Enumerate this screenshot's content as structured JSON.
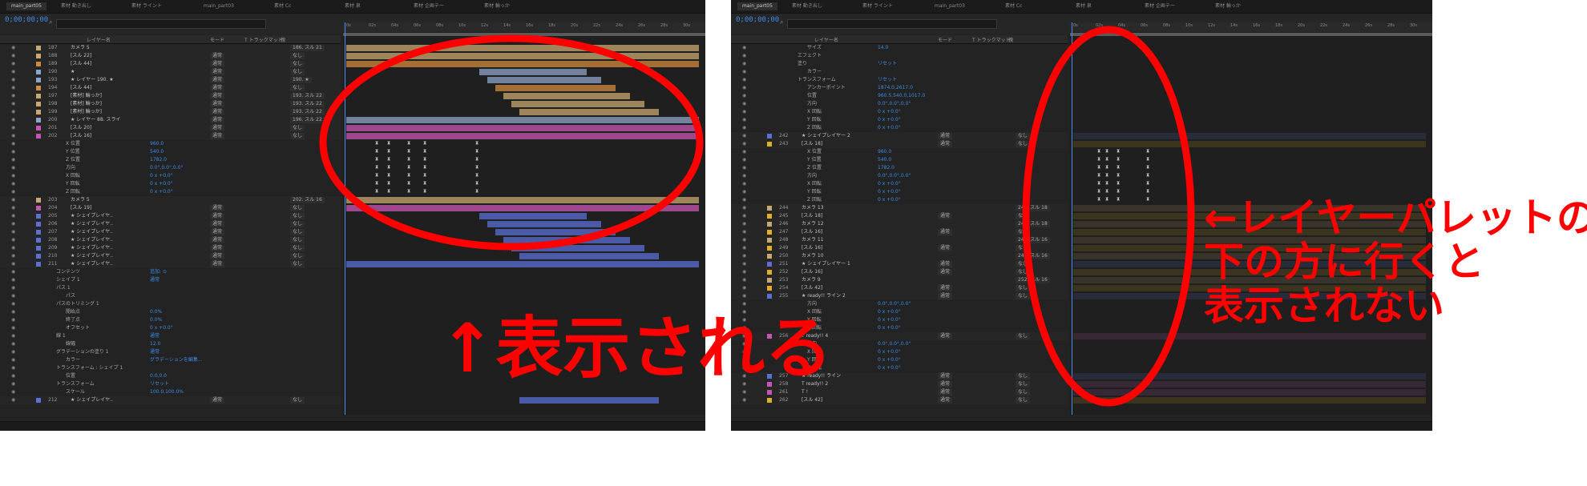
{
  "colors": {
    "annotation": "#ff0000",
    "timecode": "#3d8be6",
    "panel_bg": "#232323"
  },
  "annotations": {
    "shown": "↑表示される",
    "not_shown": "←レイヤーパレットの\n下の方に行くと\n表示されない"
  },
  "panels": [
    {
      "id": "p1",
      "tabs": [
        "main_part05",
        "素材 動き出し",
        "素材 ライント",
        "main_part03",
        "素材 Cc",
        "素材 泉",
        "素材 企画テー",
        "素材 輪っか"
      ],
      "timecode": "0;00;00;00",
      "search_icon": "search-icon",
      "columns": {
        "layer_name": "レイヤー名",
        "mode": "モード",
        "track_matte": "T トラックマット",
        "parent": "親"
      },
      "ruler": [
        "0s",
        "02s",
        "04s",
        "06s",
        "08s",
        "10s",
        "12s",
        "14s",
        "16s",
        "18s",
        "20s",
        "22s",
        "24s",
        "26s",
        "28s",
        "30s"
      ],
      "rows": [
        {
          "n": "187",
          "name": "カメラ 5",
          "kind": "layer",
          "color": "#c9a870",
          "parent": "186. スル 21"
        },
        {
          "n": "188",
          "name": "[スル 22]",
          "kind": "layer",
          "color": "#c9a870",
          "mode": "通常",
          "parent": "なし"
        },
        {
          "n": "189",
          "name": "[スル 44]",
          "kind": "layer",
          "color": "#d18b3c",
          "mode": "通常",
          "parent": "なし"
        },
        {
          "n": "190",
          "name": "★",
          "kind": "layer",
          "color": "#8fa3c8",
          "mode": "通常",
          "parent": "なし"
        },
        {
          "n": "193",
          "name": "★ レイヤー 190. ★",
          "kind": "layer",
          "color": "#8fa3c8",
          "mode": "通常",
          "parent": "190. ★"
        },
        {
          "n": "194",
          "name": "[スル 44]",
          "kind": "layer",
          "color": "#d18b3c",
          "mode": "通常",
          "parent": "なし"
        },
        {
          "n": "197",
          "name": "[素材] 輪っか]",
          "kind": "layer",
          "color": "#c9a870",
          "mode": "通常",
          "parent": "193. スル 22"
        },
        {
          "n": "198",
          "name": "[素材] 輪っか]",
          "kind": "layer",
          "color": "#c9a870",
          "mode": "通常",
          "parent": "193. スル 22"
        },
        {
          "n": "199",
          "name": "[素材] 輪っか]",
          "kind": "layer",
          "color": "#c9a870",
          "mode": "通常",
          "parent": "193. スル 22"
        },
        {
          "n": "200",
          "name": "★ レイヤー 88. スライ",
          "kind": "layer",
          "color": "#8fa3c8",
          "mode": "通常",
          "parent": "196. スル 22"
        },
        {
          "n": "201",
          "name": "[スル 20]",
          "kind": "layer",
          "color": "#c855b5",
          "mode": "通常",
          "parent": "なし"
        },
        {
          "n": "202",
          "name": "[スル 16]",
          "kind": "layer",
          "color": "#c855b5",
          "mode": "通常",
          "parent": "なし"
        },
        {
          "name": "X 位置",
          "kind": "prop",
          "value": "960.0"
        },
        {
          "name": "Y 位置",
          "kind": "prop",
          "value": "540.0"
        },
        {
          "name": "Z 位置",
          "kind": "prop",
          "value": "1782.0"
        },
        {
          "name": "方向",
          "kind": "prop",
          "value": "0.0°,0.0°,0.0°"
        },
        {
          "name": "X 回転",
          "kind": "prop",
          "value": "0 x +0.0°"
        },
        {
          "name": "Y 回転",
          "kind": "prop",
          "value": "0 x +0.0°"
        },
        {
          "name": "Z 回転",
          "kind": "prop",
          "value": "0 x +0.0°"
        },
        {
          "n": "203",
          "name": "カメラ 5",
          "kind": "layer",
          "color": "#c9a870",
          "parent": "202. スル 16"
        },
        {
          "n": "204",
          "name": "[スル 19]",
          "kind": "layer",
          "color": "#c855b5",
          "mode": "通常",
          "parent": "なし"
        },
        {
          "n": "205",
          "name": "★ シェイプレイヤ..",
          "kind": "layer",
          "color": "#5b6fd6",
          "mode": "通常",
          "parent": "なし"
        },
        {
          "n": "206",
          "name": "★ シェイプレイヤ..",
          "kind": "layer",
          "color": "#5b6fd6",
          "mode": "通常",
          "parent": "なし"
        },
        {
          "n": "207",
          "name": "★ シェイプレイヤ..",
          "kind": "layer",
          "color": "#5b6fd6",
          "mode": "通常",
          "parent": "なし"
        },
        {
          "n": "208",
          "name": "★ シェイプレイヤ..",
          "kind": "layer",
          "color": "#5b6fd6",
          "mode": "通常",
          "parent": "なし"
        },
        {
          "n": "209",
          "name": "★ シェイプレイヤ..",
          "kind": "layer",
          "color": "#5b6fd6",
          "mode": "通常",
          "parent": "なし"
        },
        {
          "n": "210",
          "name": "★ シェイプレイヤ..",
          "kind": "layer",
          "color": "#5b6fd6",
          "mode": "通常",
          "parent": "なし"
        },
        {
          "n": "211",
          "name": "★ シェイプレイヤ..",
          "kind": "layer",
          "color": "#5b6fd6",
          "mode": "通常",
          "parent": "なし"
        },
        {
          "name": "コンテンツ",
          "kind": "group",
          "value": "追加: ⊙"
        },
        {
          "name": "シェイプ 1",
          "kind": "group",
          "value": "通常"
        },
        {
          "name": "パス 1",
          "kind": "group"
        },
        {
          "name": "パス",
          "kind": "prop"
        },
        {
          "name": "パスのトリミング 1",
          "kind": "group"
        },
        {
          "name": "開始点",
          "kind": "prop",
          "value": "0.0%"
        },
        {
          "name": "終了点",
          "kind": "prop",
          "value": "0.0%"
        },
        {
          "name": "オフセット",
          "kind": "prop",
          "value": "0 x +0.0°"
        },
        {
          "name": "線 1",
          "kind": "group",
          "value": "通常"
        },
        {
          "name": "線幅",
          "kind": "prop",
          "value": "12.0"
        },
        {
          "name": "グラデーションの塗り 1",
          "kind": "group",
          "value": "通常"
        },
        {
          "name": "カラー",
          "kind": "prop",
          "value": "グラデーションを編集..."
        },
        {
          "name": "トランスフォーム : シェイプ 1",
          "kind": "group"
        },
        {
          "name": "位置",
          "kind": "prop",
          "value": "0.0,0.0"
        },
        {
          "name": "トランスフォーム",
          "kind": "group",
          "value": "リセット"
        },
        {
          "name": "スケール",
          "kind": "prop",
          "value": "100.0,100.0%"
        },
        {
          "n": "212",
          "name": "★ シェイプレイヤ..",
          "kind": "layer",
          "color": "#5b6fd6",
          "mode": "通常",
          "parent": "なし"
        }
      ]
    },
    {
      "id": "p2",
      "tabs": [
        "main_part05",
        "素材 動き出し",
        "素材 ライント",
        "main_part03",
        "素材 Cc",
        "素材 泉",
        "素材 企画テー",
        "素材 輪っか"
      ],
      "timecode": "0;00;00;00",
      "search_icon": "search-icon",
      "columns": {
        "layer_name": "レイヤー名",
        "mode": "モード",
        "track_matte": "T トラックマット",
        "parent": "親"
      },
      "ruler": [
        "0s",
        "02s",
        "04s",
        "06s",
        "08s",
        "10s",
        "12s",
        "14s",
        "16s",
        "18s",
        "20s",
        "22s",
        "24s",
        "26s",
        "28s",
        "30s"
      ],
      "rows": [
        {
          "name": "サイズ",
          "kind": "prop",
          "value": "14.0"
        },
        {
          "name": "エフェクト",
          "kind": "group"
        },
        {
          "name": "塗り",
          "kind": "group",
          "value": "リセット"
        },
        {
          "name": "カラー",
          "kind": "prop"
        },
        {
          "name": "トランスフォーム",
          "kind": "group",
          "value": "リセット"
        },
        {
          "name": "アンカーポイント",
          "kind": "prop",
          "value": "1874.0,2617.0"
        },
        {
          "name": "位置",
          "kind": "prop",
          "value": "960.5,540.0,1017.0"
        },
        {
          "name": "方向",
          "kind": "prop",
          "value": "0.0°,0.0°,0.0°"
        },
        {
          "name": "X 回転",
          "kind": "prop",
          "value": "0 x +0.0°"
        },
        {
          "name": "Y 回転",
          "kind": "prop",
          "value": "0 x +0.0°"
        },
        {
          "name": "Z 回転",
          "kind": "prop",
          "value": "0 x +0.0°"
        },
        {
          "n": "242",
          "name": "★ シェイプレイヤー 2",
          "kind": "layer",
          "color": "#5b6fd6",
          "mode": "通常",
          "parent": "なし"
        },
        {
          "n": "243",
          "name": "[スル 18]",
          "kind": "layer",
          "color": "#e0b020",
          "mode": "通常",
          "parent": "なし"
        },
        {
          "name": "X 位置",
          "kind": "prop",
          "value": "960.0"
        },
        {
          "name": "Y 位置",
          "kind": "prop",
          "value": "540.0"
        },
        {
          "name": "Z 位置",
          "kind": "prop",
          "value": "1782.0"
        },
        {
          "name": "方向",
          "kind": "prop",
          "value": "0.0°,0.0°,0.0°"
        },
        {
          "name": "X 回転",
          "kind": "prop",
          "value": "0 x +0.0°"
        },
        {
          "name": "Y 回転",
          "kind": "prop",
          "value": "0 x +0.0°"
        },
        {
          "name": "Z 回転",
          "kind": "prop",
          "value": "0 x +0.0°"
        },
        {
          "n": "244",
          "name": "カメラ 13",
          "kind": "layer",
          "color": "#c9a870",
          "parent": "243. スル 18"
        },
        {
          "n": "245",
          "name": "[スル 18]",
          "kind": "layer",
          "color": "#e0b020",
          "mode": "通常",
          "parent": "なし"
        },
        {
          "n": "246",
          "name": "カメラ 12",
          "kind": "layer",
          "color": "#c9a870",
          "parent": "245. スル 18"
        },
        {
          "n": "247",
          "name": "[スル 16]",
          "kind": "layer",
          "color": "#e0b020",
          "mode": "通常",
          "parent": "なし"
        },
        {
          "n": "248",
          "name": "カメラ 11",
          "kind": "layer",
          "color": "#c9a870",
          "parent": "247. スル 16"
        },
        {
          "n": "249",
          "name": "[スル 16]",
          "kind": "layer",
          "color": "#e0b020",
          "mode": "通常",
          "parent": "なし"
        },
        {
          "n": "250",
          "name": "カメラ 10",
          "kind": "layer",
          "color": "#c9a870",
          "parent": "249. スル 16"
        },
        {
          "n": "251",
          "name": "★ シェイプレイヤー 1",
          "kind": "layer",
          "color": "#5b6fd6",
          "mode": "通常",
          "parent": "なし"
        },
        {
          "n": "252",
          "name": "[スル 16]",
          "kind": "layer",
          "color": "#e0b020",
          "mode": "通常",
          "parent": "なし"
        },
        {
          "n": "253",
          "name": "カメラ 9",
          "kind": "layer",
          "color": "#c9a870",
          "parent": "252. スル 16"
        },
        {
          "n": "254",
          "name": "[スル 42]",
          "kind": "layer",
          "color": "#e0b020",
          "mode": "通常",
          "parent": "なし"
        },
        {
          "n": "255",
          "name": "★ ready!! ライン 2",
          "kind": "layer",
          "color": "#5b6fd6",
          "mode": "通常",
          "parent": "なし"
        },
        {
          "name": "方向",
          "kind": "prop",
          "value": "0.0°,0.0°,0.0°"
        },
        {
          "name": "X 回転",
          "kind": "prop",
          "value": "0 x +0.0°"
        },
        {
          "name": "Y 回転",
          "kind": "prop",
          "value": "0 x +0.0°"
        },
        {
          "name": "Z 回転",
          "kind": "prop",
          "value": "0 x +0.0°"
        },
        {
          "n": "256",
          "name": "T ready!! 4",
          "kind": "layer",
          "color": "#c855b5",
          "mode": "通常",
          "parent": "なし"
        },
        {
          "name": "方向",
          "kind": "prop",
          "value": "0.0°,0.0°,0.0°"
        },
        {
          "name": "X 回転",
          "kind": "prop",
          "value": "0 x +0.0°"
        },
        {
          "name": "Y 回転",
          "kind": "prop",
          "value": "0 x +0.0°"
        },
        {
          "name": "Z 回転",
          "kind": "prop",
          "value": "0 x +0.0°"
        },
        {
          "n": "257",
          "name": "★ ready!! ライン",
          "kind": "layer",
          "color": "#5b6fd6",
          "mode": "通常",
          "parent": "なし"
        },
        {
          "n": "258",
          "name": "T ready!! 2",
          "kind": "layer",
          "color": "#c855b5",
          "mode": "通常",
          "parent": "なし"
        },
        {
          "n": "261",
          "name": "T !",
          "kind": "layer",
          "color": "#c855b5",
          "mode": "通常",
          "parent": "なし"
        },
        {
          "n": "262",
          "name": "[スル 42]",
          "kind": "layer",
          "color": "#e0b020",
          "mode": "通常",
          "parent": "なし"
        }
      ]
    }
  ]
}
